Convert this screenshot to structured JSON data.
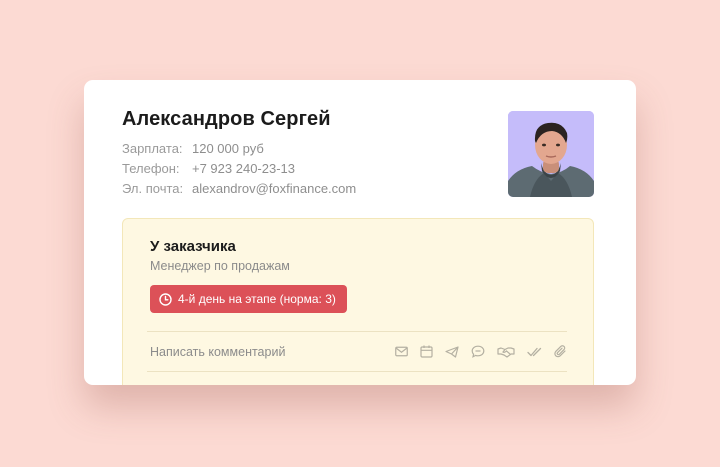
{
  "profile": {
    "name": "Александров Сергей",
    "fields": [
      {
        "label": "Зарплата:",
        "value": "120 000 руб"
      },
      {
        "label": "Телефон:",
        "value": "+7 923 240-23-13"
      },
      {
        "label": "Эл. почта:",
        "value": "alexandrov@foxfinance.com"
      }
    ]
  },
  "stage": {
    "title": "У заказчика",
    "subtitle": "Менеджер по продажам",
    "badge_text": "4-й день на этапе (норма: 3)"
  },
  "comment": {
    "placeholder": "Написать комментарий",
    "tools": [
      "mail-icon",
      "calendar-icon",
      "telegram-icon",
      "chat-icon",
      "handshake-icon",
      "double-check-icon",
      "paperclip-icon"
    ]
  },
  "colors": {
    "page_background": "#fcdad3",
    "card": "#ffffff",
    "stage_background": "#fef8e2",
    "badge": "#dc5158",
    "avatar_background": "#c5bcfa"
  }
}
